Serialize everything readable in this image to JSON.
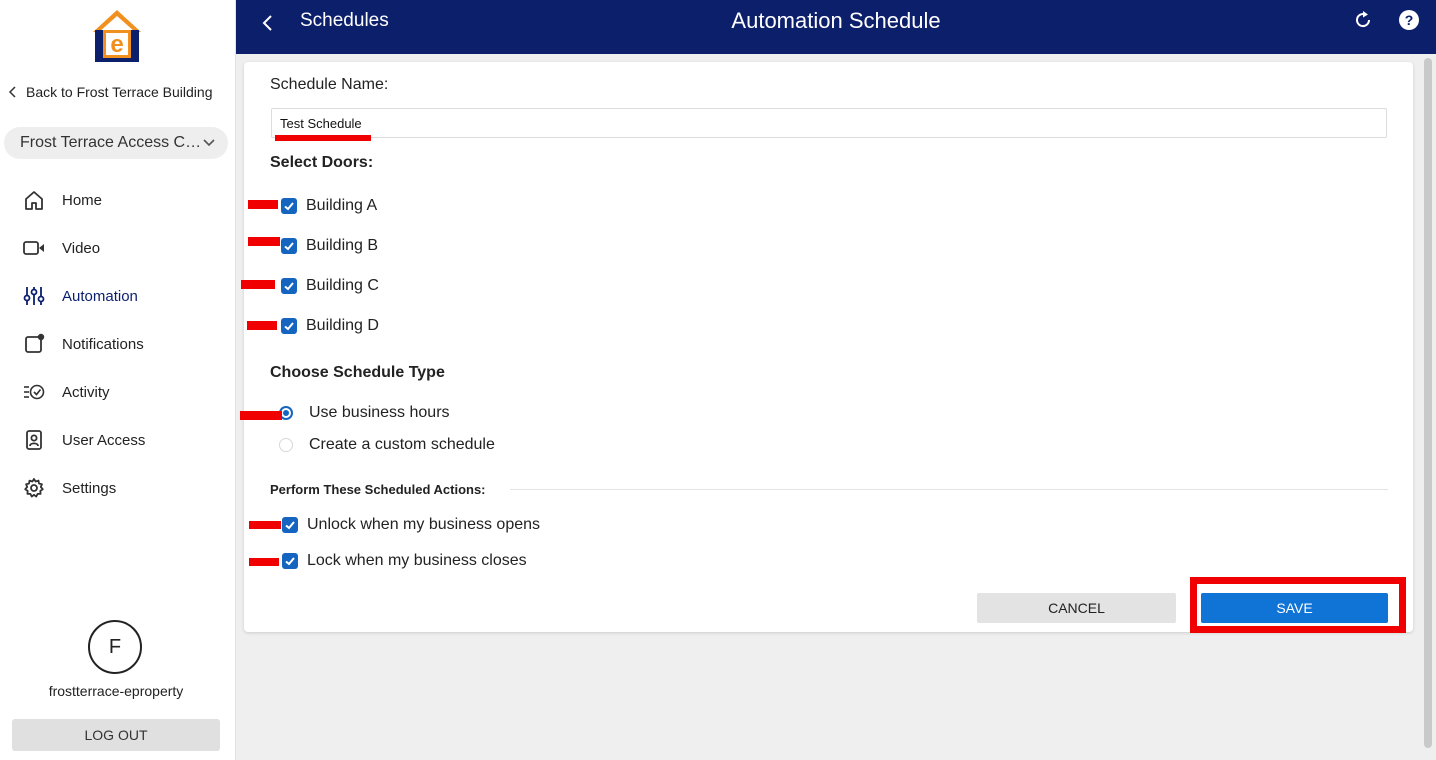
{
  "sidebar": {
    "back_link": "Back to Frost Terrace Building",
    "site_select": "Frost Terrace Access Control",
    "nav": [
      {
        "label": "Home",
        "icon": "home-icon"
      },
      {
        "label": "Video",
        "icon": "video-icon"
      },
      {
        "label": "Automation",
        "icon": "automation-icon",
        "active": true
      },
      {
        "label": "Notifications",
        "icon": "notifications-icon"
      },
      {
        "label": "Activity",
        "icon": "activity-icon"
      },
      {
        "label": "User Access",
        "icon": "user-access-icon"
      },
      {
        "label": "Settings",
        "icon": "settings-icon"
      }
    ],
    "avatar_initial": "F",
    "username": "frostterrace-eproperty",
    "logout_label": "LOG OUT"
  },
  "header": {
    "breadcrumb": "Schedules",
    "title": "Automation Schedule",
    "bg_color": "#0c1f6b"
  },
  "form": {
    "schedule_name_label": "Schedule Name:",
    "schedule_name_value": "Test Schedule",
    "select_doors_label": "Select Doors:",
    "doors": [
      {
        "label": "Building A",
        "checked": true
      },
      {
        "label": "Building B",
        "checked": true
      },
      {
        "label": "Building C",
        "checked": true
      },
      {
        "label": "Building D",
        "checked": true
      }
    ],
    "schedule_type_label": "Choose Schedule Type",
    "schedule_types": [
      {
        "label": "Use business hours",
        "selected": true
      },
      {
        "label": "Create a custom schedule",
        "selected": false
      }
    ],
    "actions_label": "Perform These Scheduled Actions:",
    "actions": [
      {
        "label": "Unlock when my business opens",
        "checked": true
      },
      {
        "label": "Lock when my business closes",
        "checked": true
      }
    ],
    "cancel_label": "CANCEL",
    "save_label": "SAVE",
    "accent_color": "#1073d6"
  }
}
